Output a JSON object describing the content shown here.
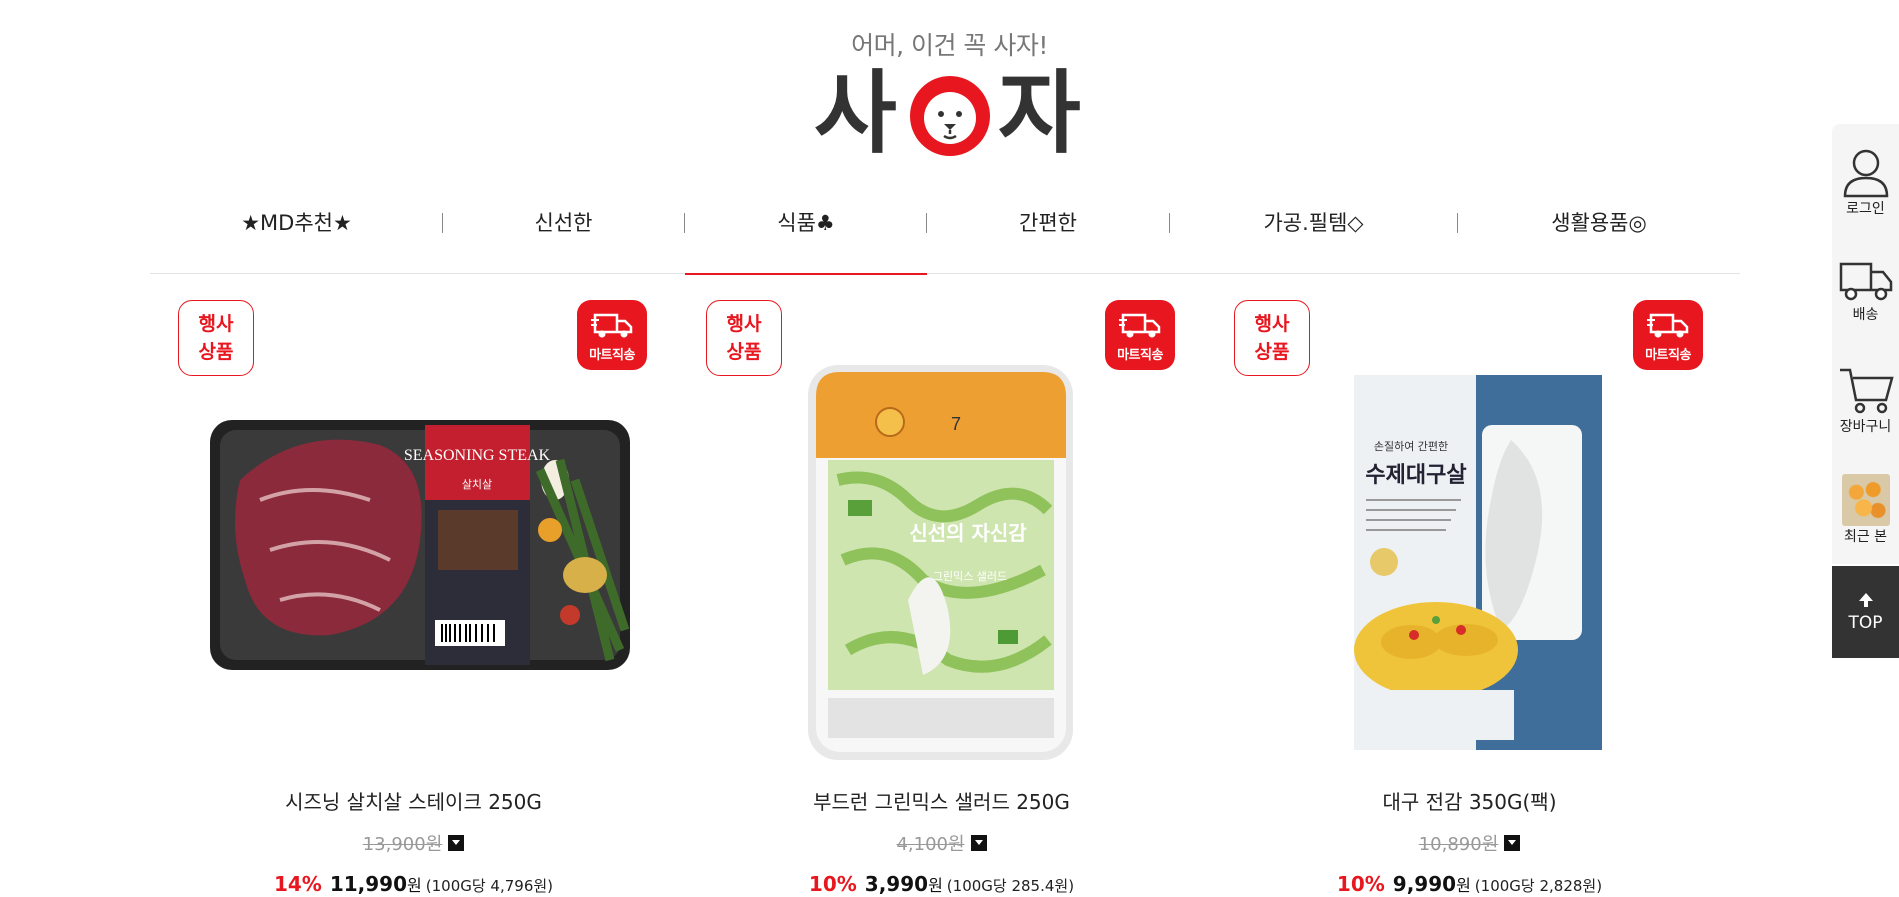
{
  "header": {
    "tagline": "어머, 이건 꼭 사자!",
    "logo_left": "사",
    "logo_right": "자"
  },
  "nav": {
    "items": [
      {
        "label": "★MD추천★",
        "active": false
      },
      {
        "label": "신선한",
        "active": false
      },
      {
        "label": "식품♣",
        "active": true
      },
      {
        "label": "간편한",
        "active": false
      },
      {
        "label": "가공.필템◇",
        "active": false
      },
      {
        "label": "생활용품◎",
        "active": false
      }
    ]
  },
  "products": [
    {
      "event_badge": "행사\n상품",
      "mart_badge": "마트직송",
      "name": "시즈닝 살치살 스테이크 250G",
      "original_price": "13,900원",
      "discount_rate": "14%",
      "sale_price": "11,990",
      "currency": "원",
      "unit_price": "(100G당 4,796원)",
      "package_text": "SEASONING STEAK",
      "package_sub": "살치살"
    },
    {
      "event_badge": "행사\n상품",
      "mart_badge": "마트직송",
      "name": "부드런 그린믹스 샐러드 250G",
      "original_price": "4,100원",
      "discount_rate": "10%",
      "sale_price": "3,990",
      "currency": "원",
      "unit_price": "(100G당 285.4원)",
      "package_text": "신선의 자신감",
      "package_sub": "그린믹스 샐러드"
    },
    {
      "event_badge": "행사\n상품",
      "mart_badge": "마트직송",
      "name": "대구 전감 350G(팩)",
      "original_price": "10,890원",
      "discount_rate": "10%",
      "sale_price": "9,990",
      "currency": "원",
      "unit_price": "(100G당 2,828원)",
      "package_text": "수제대구살",
      "package_sub": "손질하여 간편한"
    }
  ],
  "quickbar": {
    "login": "로그인",
    "delivery": "배송",
    "cart": "장바구니",
    "recent": "최근 본",
    "top": "TOP"
  },
  "colors": {
    "accent": "#e8171f",
    "text": "#222222",
    "muted": "#999999"
  }
}
